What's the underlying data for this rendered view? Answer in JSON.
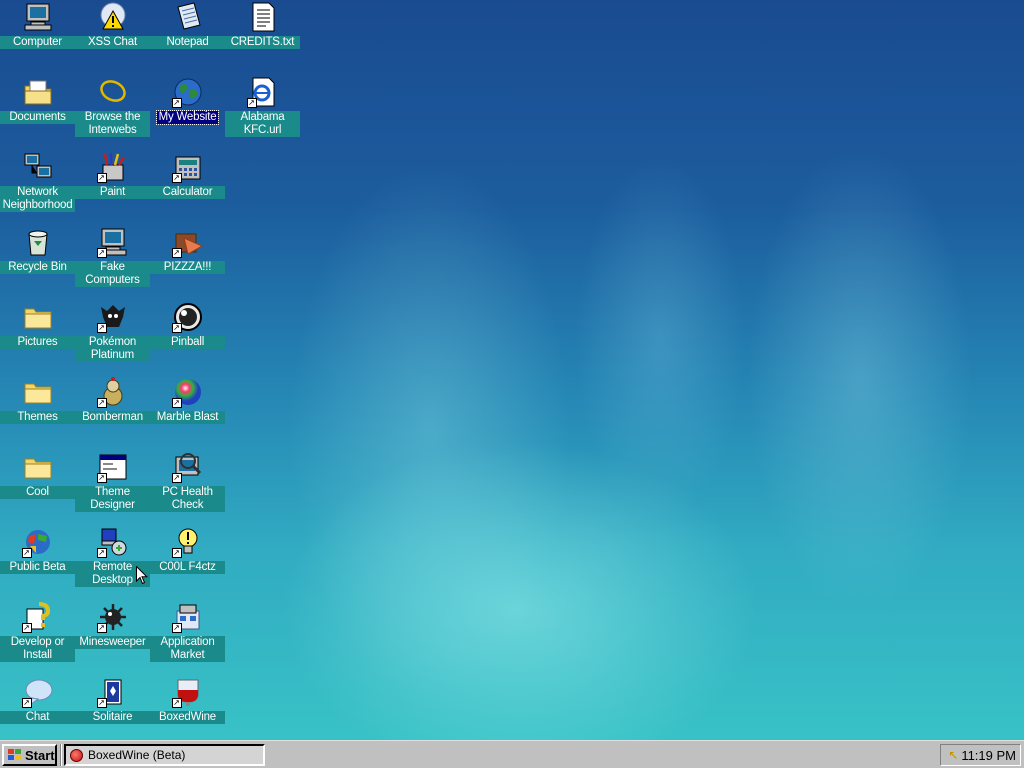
{
  "desktop": {
    "icons": [
      {
        "name": "icon-computer",
        "label": "Computer",
        "icon": "computer-icon",
        "shortcut": false
      },
      {
        "name": "icon-xss-chat",
        "label": "XSS Chat",
        "icon": "xss-chat-icon",
        "shortcut": false
      },
      {
        "name": "icon-notepad",
        "label": "Notepad",
        "icon": "notepad-icon",
        "shortcut": false
      },
      {
        "name": "icon-credits",
        "label": "CREDITS.txt",
        "icon": "text-file-icon",
        "shortcut": false
      },
      {
        "name": "icon-documents",
        "label": "Documents",
        "icon": "documents-folder-icon",
        "shortcut": false
      },
      {
        "name": "icon-browse",
        "label": "Browse the\nInterwebs",
        "icon": "browser-icon",
        "shortcut": false
      },
      {
        "name": "icon-my-website",
        "label": "My Website",
        "icon": "globe-icon",
        "shortcut": true,
        "selected": true
      },
      {
        "name": "icon-alabama-kfc",
        "label": "Alabama\nKFC.url",
        "icon": "internet-shortcut-icon",
        "shortcut": true
      },
      {
        "name": "icon-network",
        "label": "Network\nNeighborhood",
        "icon": "network-icon",
        "shortcut": false
      },
      {
        "name": "icon-paint",
        "label": "Paint",
        "icon": "paint-icon",
        "shortcut": true
      },
      {
        "name": "icon-calculator",
        "label": "Calculator",
        "icon": "calculator-icon",
        "shortcut": true
      },
      {
        "name": "icon-recycle-bin",
        "label": "Recycle Bin",
        "icon": "recycle-bin-icon",
        "shortcut": false
      },
      {
        "name": "icon-fake-computers",
        "label": "Fake\nComputers",
        "icon": "computer-icon",
        "shortcut": true
      },
      {
        "name": "icon-pizza",
        "label": "PIZZZA!!!",
        "icon": "pizza-icon",
        "shortcut": true
      },
      {
        "name": "icon-pictures",
        "label": "Pictures",
        "icon": "folder-icon",
        "shortcut": false
      },
      {
        "name": "icon-pokemon",
        "label": "Pokémon\nPlatinum",
        "icon": "pokemon-icon",
        "shortcut": true
      },
      {
        "name": "icon-pinball",
        "label": "Pinball",
        "icon": "pinball-icon",
        "shortcut": true
      },
      {
        "name": "icon-themes",
        "label": "Themes",
        "icon": "folder-icon",
        "shortcut": false
      },
      {
        "name": "icon-bomberman",
        "label": "Bomberman",
        "icon": "bomberman-icon",
        "shortcut": true
      },
      {
        "name": "icon-marble-blast",
        "label": "Marble Blast",
        "icon": "marble-icon",
        "shortcut": true
      },
      {
        "name": "icon-cool",
        "label": "Cool",
        "icon": "folder-icon",
        "shortcut": false
      },
      {
        "name": "icon-theme-designer",
        "label": "Theme\nDesigner",
        "icon": "window-icon",
        "shortcut": true
      },
      {
        "name": "icon-pc-health",
        "label": "PC Health\nCheck",
        "icon": "health-check-icon",
        "shortcut": true
      },
      {
        "name": "icon-public-beta",
        "label": "Public Beta",
        "icon": "public-beta-icon",
        "shortcut": true
      },
      {
        "name": "icon-remote-desktop",
        "label": "Remote\nDesktop",
        "icon": "remote-desktop-icon",
        "shortcut": true
      },
      {
        "name": "icon-cool-facts",
        "label": "C00L F4ctz",
        "icon": "lightbulb-icon",
        "shortcut": true
      },
      {
        "name": "icon-develop",
        "label": "Develop or\nInstall",
        "icon": "develop-icon",
        "shortcut": true
      },
      {
        "name": "icon-minesweeper",
        "label": "Minesweeper",
        "icon": "mine-icon",
        "shortcut": true
      },
      {
        "name": "icon-app-market",
        "label": "Application\nMarket",
        "icon": "market-icon",
        "shortcut": true
      },
      {
        "name": "icon-chat",
        "label": "Chat",
        "icon": "chat-bubble-icon",
        "shortcut": true
      },
      {
        "name": "icon-solitaire",
        "label": "Solitaire",
        "icon": "solitaire-icon",
        "shortcut": true
      },
      {
        "name": "icon-boxedwine",
        "label": "BoxedWine",
        "icon": "wine-glass-icon",
        "shortcut": true
      }
    ]
  },
  "taskbar": {
    "start_label": "Start",
    "task_label": "BoxedWine (Beta)",
    "clock": "11:19 PM"
  },
  "colors": {
    "label_bg": "#1a8a8a",
    "selection": "#000080",
    "taskbar": "#c0c0c0"
  }
}
